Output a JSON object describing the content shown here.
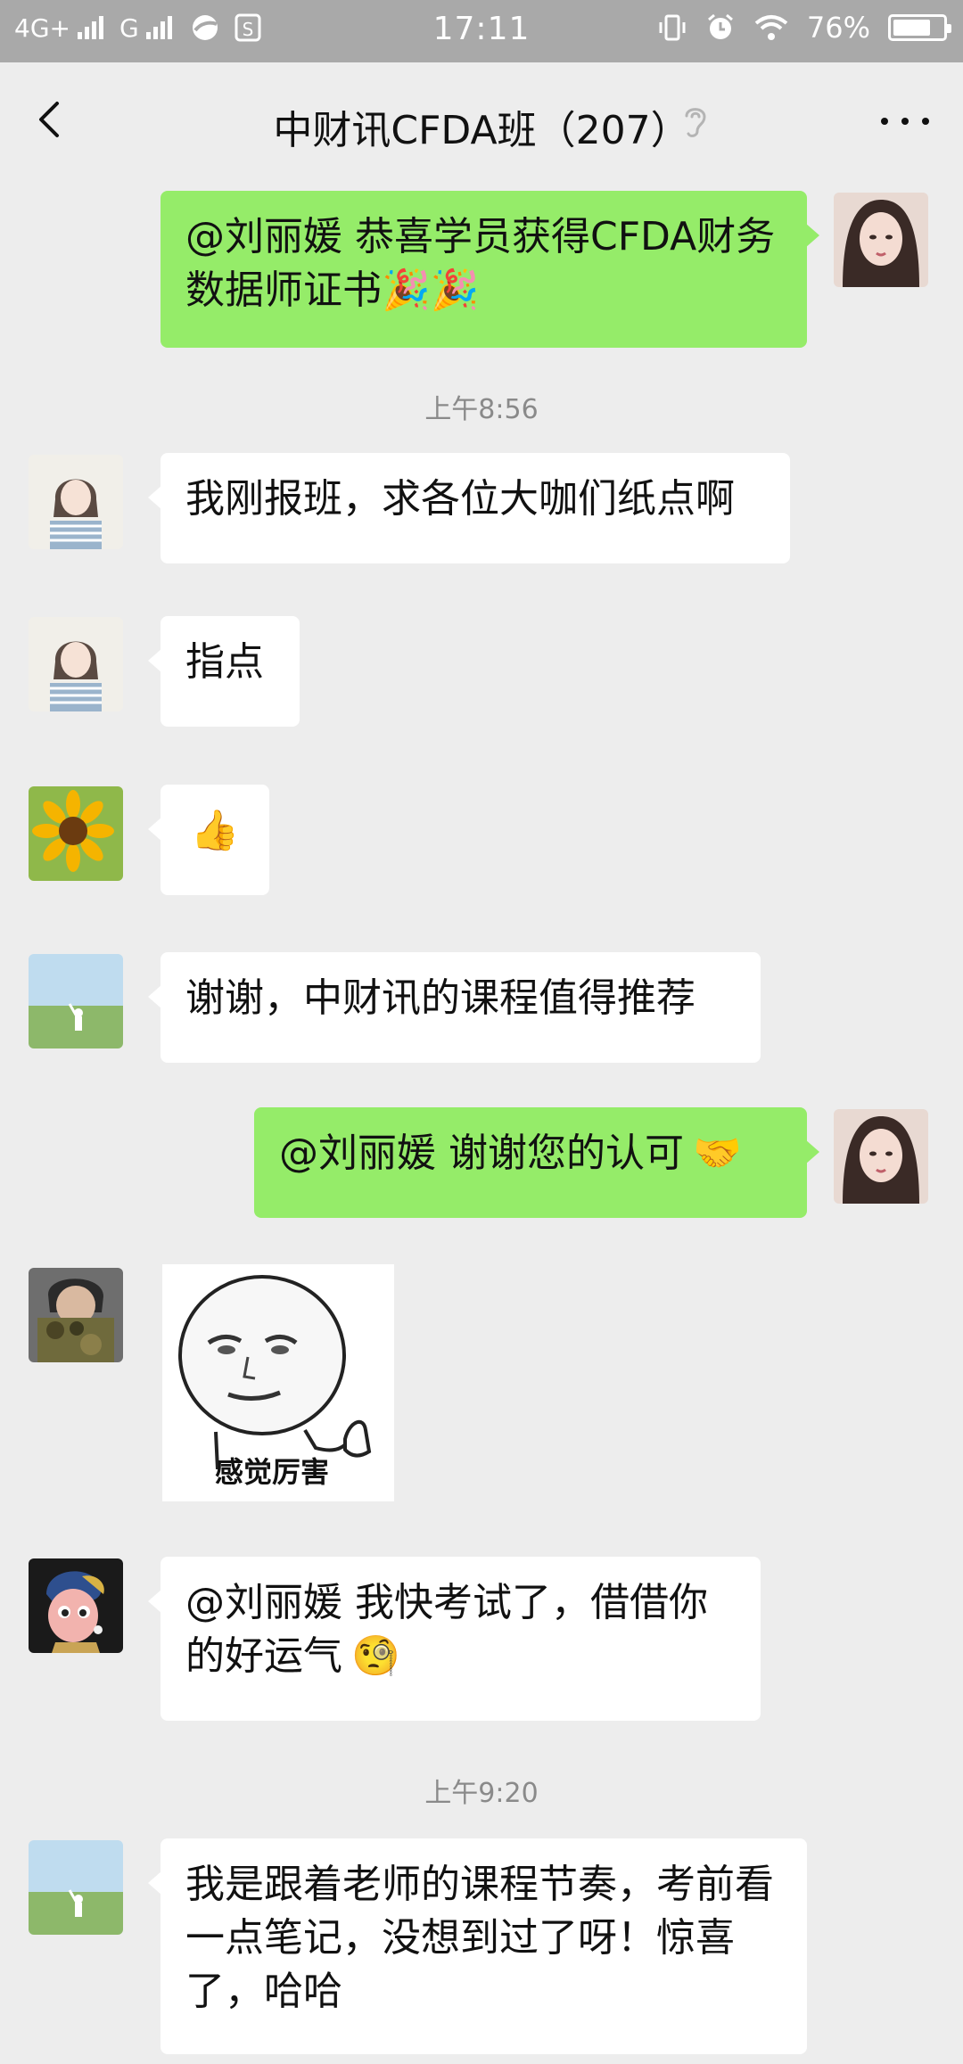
{
  "status_bar": {
    "network_1": "4G+",
    "network_2": "G",
    "time": "17:11",
    "battery": "76%",
    "battery_level": 0.76
  },
  "nav": {
    "title": "中财讯CFDA班（207）"
  },
  "timestamps": {
    "t1": "上午8:56",
    "t2": "上午9:20"
  },
  "messages": {
    "m1": {
      "text": "@刘丽媛 恭喜学员获得CFDA财务数据师证书",
      "emoji": "🎉🎉"
    },
    "m2": {
      "text": "我刚报班，求各位大咖们纸点啊"
    },
    "m3": {
      "text": "指点"
    },
    "m4": {
      "emoji": "👍"
    },
    "m5": {
      "text": "谢谢，中财讯的课程值得推荐"
    },
    "m6": {
      "text": "@刘丽媛 谢谢您的认可",
      "emoji": "🤝"
    },
    "m7": {
      "sticker_caption": "感觉厉害"
    },
    "m8": {
      "text": "@刘丽媛 我快考试了，借借你的好运气",
      "emoji": "🧐"
    },
    "m9": {
      "text": "我是跟着老师的课程节奏，考前看一点笔记，没想到过了呀！惊喜了，哈哈"
    }
  },
  "colors": {
    "chat_background": "#ededed",
    "sent_bubble": "#95ec69",
    "received_bubble": "#ffffff"
  }
}
